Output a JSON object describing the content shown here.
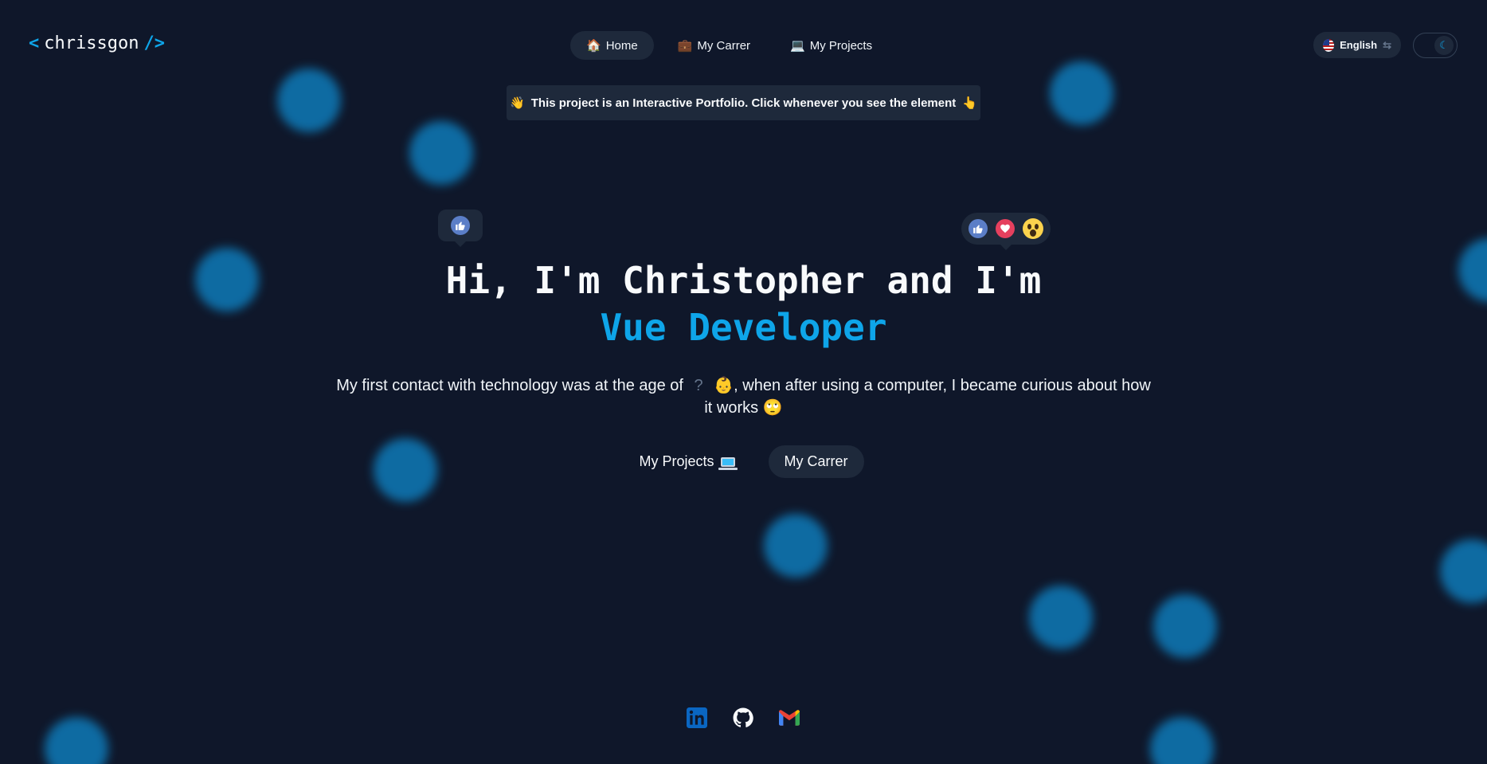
{
  "header": {
    "logo_left": "<",
    "logo_text": "chrissgon",
    "logo_right": "/>",
    "nav": [
      {
        "label": "Home",
        "icon": "house-icon"
      },
      {
        "label": "My Carrer",
        "icon": "briefcase-icon"
      },
      {
        "label": "My Projects",
        "icon": "laptop-icon"
      }
    ],
    "language": "English",
    "theme": "dark"
  },
  "banner": {
    "text": "This project is an Interactive Portfolio. Click whenever you see the element"
  },
  "hero": {
    "title": "Hi, I'm Christopher and I'm",
    "role": "Vue Developer",
    "intro_before": "My first contact with technology was at the age of",
    "age_placeholder": "?",
    "intro_after": ", when after using a computer, I became curious about how it works",
    "cta_projects": "My Projects",
    "cta_carrer": "My Carrer"
  },
  "reactions": [
    "like",
    "heart",
    "wow"
  ],
  "colors": {
    "background": "#0f172a",
    "accent": "#0ea5e9",
    "surface": "#1e293b"
  },
  "socials": [
    "linkedin-icon",
    "github-icon",
    "gmail-icon"
  ]
}
